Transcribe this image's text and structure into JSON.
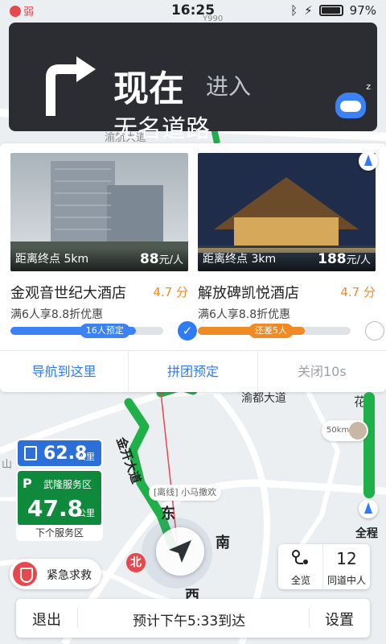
{
  "status_bar": {
    "signal_label": "弱",
    "time": "16:25",
    "battery_percent": "97%",
    "battery_level": 0.97
  },
  "turn": {
    "action": "现在",
    "verb": "进入",
    "road": "无名道路"
  },
  "map_labels": {
    "road_top": "渝航大道",
    "road_mid": "渝都大道",
    "road_green": "金开大道",
    "hua": "花",
    "y990": "Y990",
    "mountain": "山"
  },
  "hotels": [
    {
      "distance": "距离终点 5km",
      "price": "88",
      "price_unit": "元/人",
      "name": "金观音世纪大酒店",
      "score": "4.7 分",
      "deal": "满6人享8.8折优惠",
      "progress_tag": "16人预定",
      "progress": 0.82,
      "selected": true,
      "bar_color": "#3b82f6"
    },
    {
      "distance": "距离终点 3km",
      "price": "188",
      "price_unit": "元/人",
      "name": "解放碑凯悦酒店",
      "score": "4.7 分",
      "deal": "满6人享8.8折优惠",
      "progress_tag": "还差5人",
      "progress": 0.7,
      "selected": false,
      "bar_color": "#f08a24"
    }
  ],
  "panel_actions": {
    "navigate": "导航到这里",
    "group_book": "拼团预定",
    "close": "关闭10s"
  },
  "rail": {
    "full_route_label": "全程"
  },
  "teammate_chip": {
    "distance": "50km"
  },
  "service_signs": {
    "fuel_distance": "62.8",
    "fuel_unit": "公里",
    "service_name": "武隆服务区",
    "service_distance": "47.8",
    "service_unit": "公里",
    "caption": "下个服务区"
  },
  "map_tag": "[离线] 小马撒欢",
  "compass": {
    "east": "东",
    "south": "南",
    "west": "西",
    "north": "北"
  },
  "emergency": {
    "label": "紧急求救"
  },
  "overview": {
    "label": "全览",
    "teammates_count": "12",
    "teammates_label": "同道中人"
  },
  "bottom_bar": {
    "exit": "退出",
    "eta": "预计下午5:33到达",
    "settings": "设置"
  },
  "colors": {
    "accent": "#2f7bf5",
    "route_green": "#1fb04a",
    "turn_card_bg": "#2b2d33",
    "score_orange": "#f08a24",
    "sos_red": "#e5484d"
  }
}
